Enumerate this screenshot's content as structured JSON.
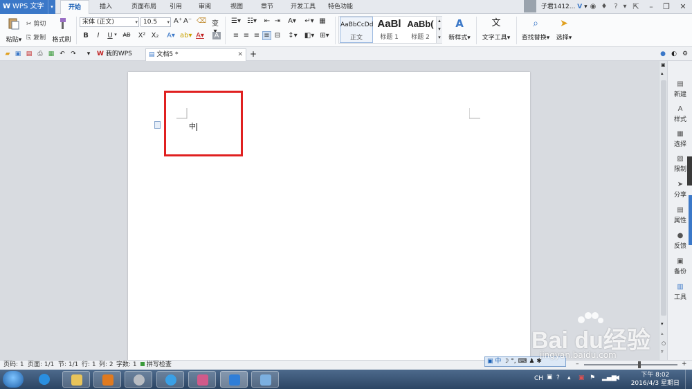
{
  "app": {
    "name": "WPS 文字",
    "logo_letter": "W"
  },
  "menu_tabs": [
    {
      "label": "开始",
      "active": true
    },
    {
      "label": "插入"
    },
    {
      "label": "页面布局"
    },
    {
      "label": "引用"
    },
    {
      "label": "审阅"
    },
    {
      "label": "视图"
    },
    {
      "label": "章节"
    },
    {
      "label": "开发工具"
    },
    {
      "label": "特色功能"
    }
  ],
  "user": {
    "name": "子君1412...",
    "help": "?"
  },
  "ribbon": {
    "paste": "粘贴",
    "cut": "剪切",
    "copy": "复制",
    "format_painter": "格式刷",
    "font_name": "宋体 (正文)",
    "font_size": "10.5",
    "bold": "B",
    "italic": "I",
    "underline": "U",
    "strike": "AB",
    "superscript": "X²",
    "subscript": "X₂",
    "styles": [
      {
        "preview": "AaBbCcDd",
        "name": "正文"
      },
      {
        "preview": "AaBl",
        "name": "标题 1"
      },
      {
        "preview": "AaBb(",
        "name": "标题 2"
      }
    ],
    "new_style": "新样式",
    "text_tools": "文字工具",
    "find_replace": "查找替换",
    "select": "选择"
  },
  "doc_tabs": [
    {
      "label": "我的WPS"
    },
    {
      "label": "文档5 *",
      "active": true
    }
  ],
  "document": {
    "text": "中"
  },
  "sidebar": [
    {
      "label": "新建",
      "icon": "new-doc-icon"
    },
    {
      "label": "样式",
      "icon": "style-icon"
    },
    {
      "label": "选择",
      "icon": "select-icon"
    },
    {
      "label": "限制",
      "icon": "restrict-icon"
    },
    {
      "label": "分享",
      "icon": "share-icon"
    },
    {
      "label": "属性",
      "icon": "properties-icon"
    },
    {
      "label": "反馈",
      "icon": "feedback-icon"
    },
    {
      "label": "备份",
      "icon": "backup-icon"
    },
    {
      "label": "工具",
      "icon": "tools-icon"
    }
  ],
  "status": {
    "page_num": "页码: 1",
    "pages": "页面: 1/1",
    "section": "节: 1/1",
    "row": "行: 1",
    "col": "列: 2",
    "words": "字数: 1",
    "spell": "拼写检查"
  },
  "ime": {
    "lang": "中"
  },
  "tray": {
    "lang": "CH",
    "time": "下午 8:02",
    "date": "2016/4/3 星期日"
  },
  "watermark": {
    "logo": "Bai du经验",
    "url": "jingyan.baidu.com"
  },
  "colors": {
    "accent": "#3b78c8",
    "highlight": "#e02020"
  }
}
